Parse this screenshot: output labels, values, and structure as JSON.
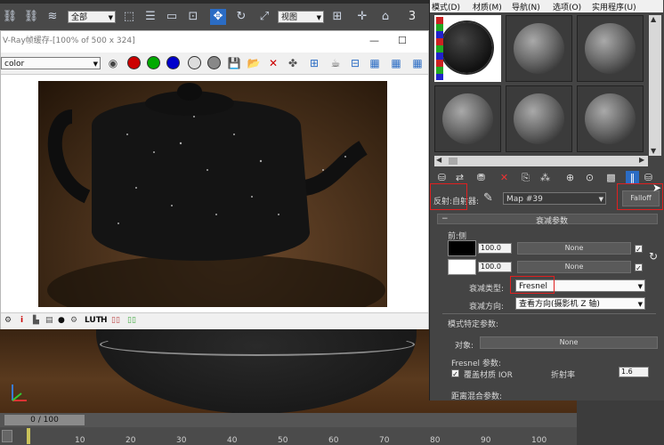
{
  "main_toolbar": {
    "dropdown_value": "全部",
    "view_dropdown": "视图",
    "number": "3"
  },
  "vfb": {
    "title": "V-Ray帧缓存-[100% of 500 x 324]",
    "channel": "color",
    "bottom_labels": [
      "i",
      "LUT",
      "H"
    ]
  },
  "timeline": {
    "slider": "0 / 100",
    "ticks": [
      "10",
      "20",
      "30",
      "40",
      "50",
      "60",
      "70",
      "80",
      "90",
      "100"
    ]
  },
  "material_editor": {
    "menu": [
      "模式(D)",
      "材质(M)",
      "导航(N)",
      "选项(O)",
      "实用程序(U)"
    ],
    "map_label": "反射:自射器:",
    "map_name": "Map #39",
    "map_type": "Falloff",
    "rollout_title": "衰减参数",
    "front_side_label": "前:侧",
    "spinner1": "100.0",
    "spinner2": "100.0",
    "none1": "None",
    "none2": "None",
    "falloff_type_label": "衰减类型:",
    "falloff_type_value": "Fresnel",
    "falloff_dir_label": "衰减方向:",
    "falloff_dir_value": "查看方向(摄影机 Z 轴)",
    "mode_params_title": "模式特定参数:",
    "object_label": "对象:",
    "object_value": "None",
    "fresnel_params_label": "Fresnel 参数:",
    "override_ior_label": "覆盖材质 IOR",
    "refraction_label": "折射率",
    "ior_value": "1.6",
    "distance_blend_label": "距离混合参数:"
  },
  "colors": {
    "accent_red": "#e02020",
    "toolbar_blue": "#2b6cc4"
  }
}
